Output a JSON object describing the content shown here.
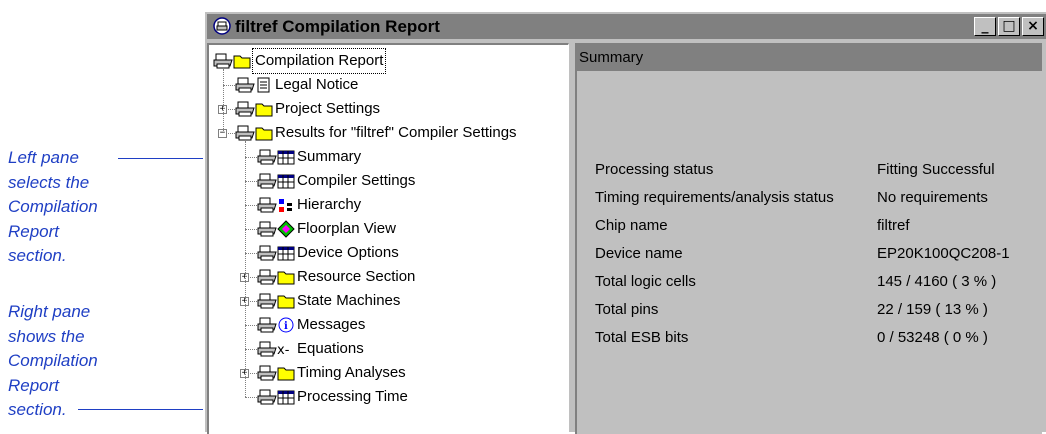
{
  "window": {
    "title": "filtref Compilation Report"
  },
  "title_buttons": {
    "minimize": "_",
    "maximize": "□",
    "close": "×"
  },
  "tree": [
    {
      "label": "Compilation Report",
      "icon": "printer-folder-open-icon"
    },
    {
      "label": "Legal Notice",
      "icon": "printer-document-icon"
    },
    {
      "label": "Project Settings",
      "icon": "printer-folder-icon"
    },
    {
      "label": "Results for \"filtref\" Compiler Settings",
      "icon": "printer-folder-open-icon"
    },
    {
      "label": "Summary",
      "icon": "printer-table-icon"
    },
    {
      "label": "Compiler Settings",
      "icon": "printer-table-icon"
    },
    {
      "label": "Hierarchy",
      "icon": "printer-hierarchy-icon"
    },
    {
      "label": "Floorplan View",
      "icon": "printer-floorplan-icon"
    },
    {
      "label": "Device Options",
      "icon": "printer-table-icon"
    },
    {
      "label": "Resource Section",
      "icon": "printer-folder-icon"
    },
    {
      "label": "State Machines",
      "icon": "printer-folder-icon"
    },
    {
      "label": "Messages",
      "icon": "printer-info-icon"
    },
    {
      "label": "Equations",
      "icon": "printer-equation-icon"
    },
    {
      "label": "Timing Analyses",
      "icon": "printer-folder-icon"
    },
    {
      "label": "Processing Time",
      "icon": "printer-table-icon"
    }
  ],
  "summary": {
    "header": "Summary",
    "rows": [
      {
        "key": "Processing status",
        "value": "Fitting Successful"
      },
      {
        "key": "Timing requirements/analysis status",
        "value": "No requirements"
      },
      {
        "key": "Chip name",
        "value": "filtref"
      },
      {
        "key": "Device name",
        "value": "EP20K100QC208-1"
      },
      {
        "key": "Total logic cells",
        "value": " 145 / 4160 ( 3 % )"
      },
      {
        "key": "Total pins",
        "value": " 22 / 159 ( 13 % )"
      },
      {
        "key": "Total ESB bits",
        "value": " 0 / 53248 ( 0 % )"
      }
    ]
  },
  "callouts": {
    "left": [
      "Left pane",
      "selects the",
      "Compilation",
      "Report",
      "section."
    ],
    "right": [
      "Right pane",
      "shows the",
      "Compilation",
      "Report",
      "section."
    ]
  },
  "colors": {
    "callout": "#1f3fc4",
    "pane_gray": "#c0c0c0",
    "header_gray": "#808080"
  }
}
